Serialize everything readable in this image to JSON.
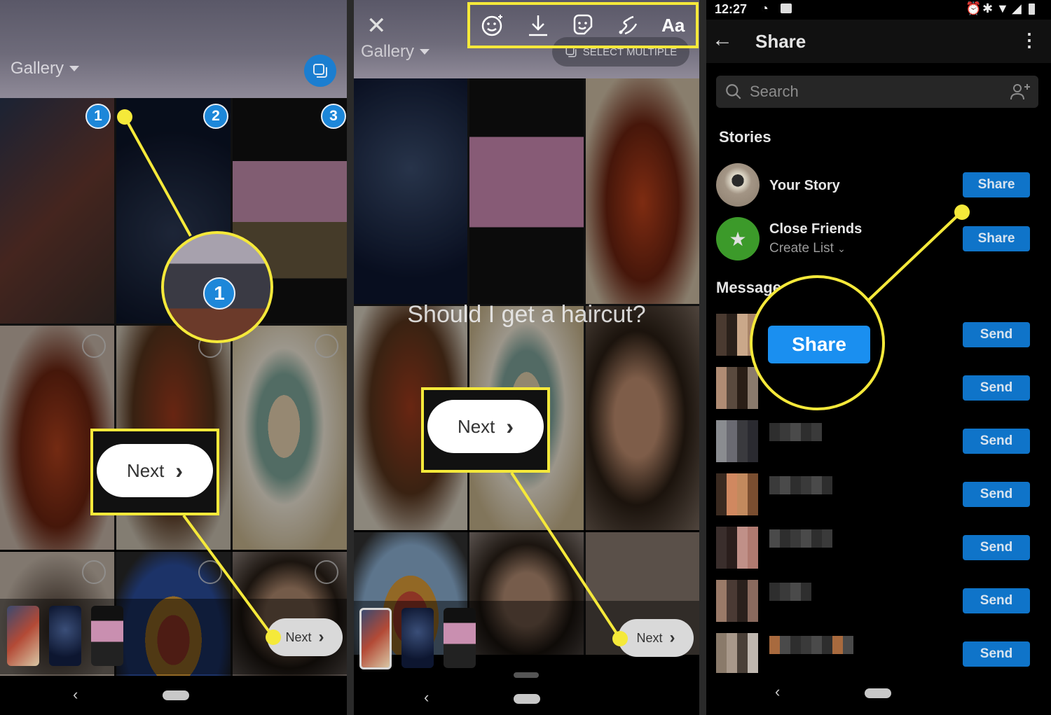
{
  "panel1": {
    "gallery_label": "Gallery",
    "multi_select_icon": "copy-multiple-icon",
    "selection_numbers": [
      "1",
      "2",
      "3"
    ],
    "zoom_callout_number": "1",
    "next_callout_label": "Next",
    "next_button_label": "Next",
    "chevron": "›"
  },
  "panel2": {
    "close_icon": "✕",
    "gallery_label": "Gallery",
    "select_multiple_label": "SELECT MULTIPLE",
    "toolbar": [
      {
        "name": "face-effects-icon",
        "glyph": "☺"
      },
      {
        "name": "download-icon",
        "glyph": "⤓"
      },
      {
        "name": "sticker-icon",
        "glyph": "☻"
      },
      {
        "name": "draw-icon",
        "glyph": "〰"
      },
      {
        "name": "text-icon",
        "glyph": "Aa"
      }
    ],
    "question_text": "Should I get a haircut?",
    "next_callout_label": "Next",
    "next_button_label": "Next",
    "chevron": "›"
  },
  "panel3": {
    "status": {
      "time": "12:27",
      "icons": [
        "sync-icon",
        "image-icon",
        "alarm-icon",
        "bluetooth-icon",
        "wifi-icon",
        "signal-icon",
        "battery-icon"
      ]
    },
    "title": "Share",
    "back_icon": "←",
    "more_icon": "⋮",
    "search": {
      "placeholder": "Search",
      "value": ""
    },
    "stories_heading": "Stories",
    "stories": [
      {
        "name": "Your Story",
        "subtitle": "",
        "button": "Share"
      },
      {
        "name": "Close Friends",
        "subtitle": "Create List",
        "button": "Share"
      }
    ],
    "messages_heading": "Messages",
    "share_callout_label": "Share",
    "messages": [
      {
        "name": "[pixelated]",
        "button": "Send"
      },
      {
        "name": "[pixelated]",
        "button": "Send"
      },
      {
        "name": "[pixelated]",
        "button": "Send"
      },
      {
        "name": "[pixelated]",
        "button": "Send"
      },
      {
        "name": "[pixelated]",
        "button": "Send"
      },
      {
        "name": "[pixelated]",
        "button": "Send"
      },
      {
        "name": "[pixelated]",
        "button": "Send"
      }
    ]
  },
  "colors": {
    "callout_yellow": "#f5e93a",
    "ig_blue": "#0f74c9",
    "badge_blue": "#1d87d9",
    "close_friends_green": "#3c9a2a"
  }
}
